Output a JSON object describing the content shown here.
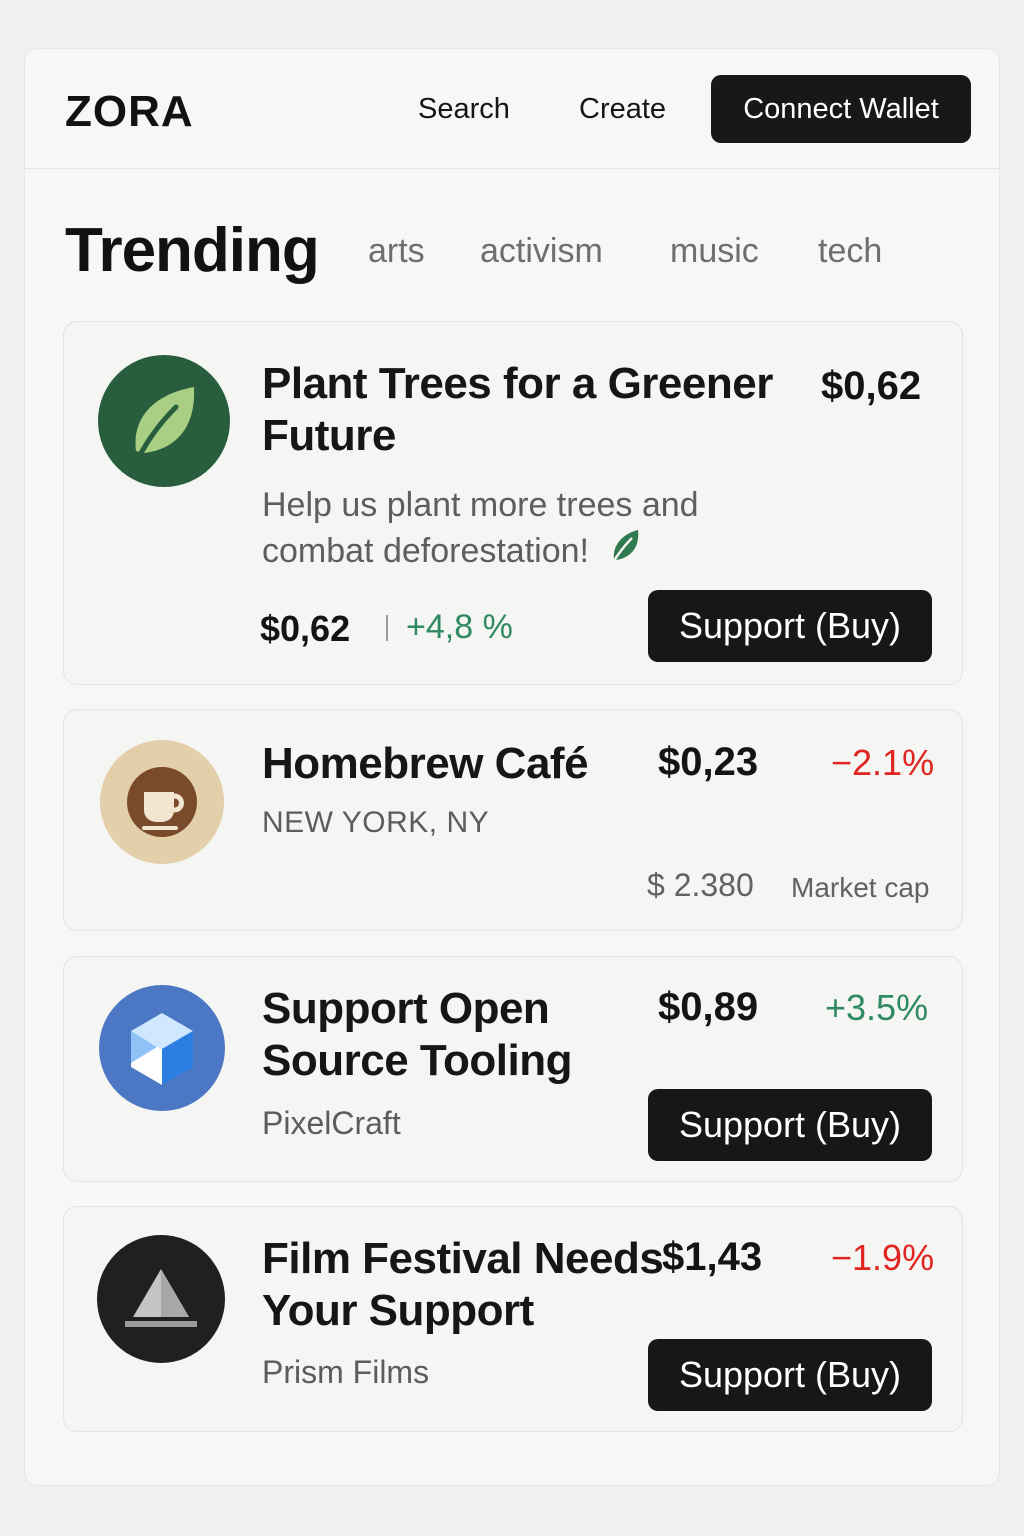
{
  "header": {
    "logo": "ZORA",
    "nav": {
      "search": "Search",
      "create": "Create"
    },
    "connect_wallet": "Connect Wallet"
  },
  "trending": {
    "title": "Trending",
    "categories": [
      "arts",
      "activism",
      "music",
      "tech"
    ]
  },
  "cards": [
    {
      "title_line1": "Plant Trees for a Greener",
      "title_line2": "Future",
      "price": "$0,62",
      "description_line1": "Help us plant more trees and",
      "description_line2": "combat deforestation!",
      "footer_price": "$0,62",
      "change": "+4,8 %",
      "button": "Support (Buy)"
    },
    {
      "title": "Homebrew Café",
      "price": "$0,23",
      "change": "−2.1%",
      "location": "NEW YORK, NY",
      "market_cap_value": "$ 2.380",
      "market_cap_label": "Market cap"
    },
    {
      "title_line1": "Support Open",
      "title_line2": "Source Tooling",
      "price": "$0,89",
      "change": "+3.5%",
      "creator": "PixelCraft",
      "button": "Support (Buy)"
    },
    {
      "title_line1": "Film Festival Needs",
      "title_line2": "Your Support",
      "price": "$1,43",
      "change": "−1.9%",
      "creator": "Prism Films",
      "button": "Support (Buy)"
    }
  ],
  "colors": {
    "positive": "#2f8a63",
    "negative": "#e0241f",
    "button": "#151718"
  },
  "icons": [
    "leaf-icon",
    "coffee-cup-icon",
    "cube-icon",
    "triangle-icon"
  ]
}
